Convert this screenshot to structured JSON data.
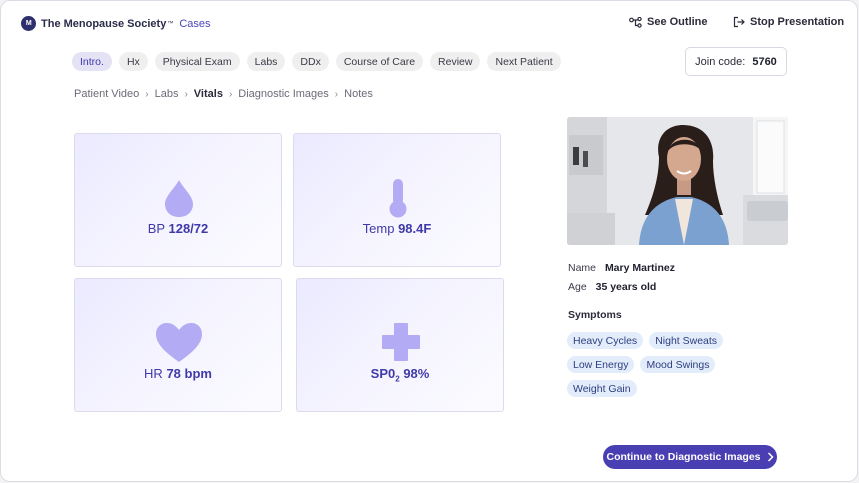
{
  "brand": {
    "mark": "M",
    "name": "The Menopause Society",
    "tm": "™",
    "product": "Cases"
  },
  "header": {
    "outline_label": "See Outline",
    "stop_label": "Stop Presentation"
  },
  "tabs": [
    {
      "label": "Intro.",
      "active": true
    },
    {
      "label": "Hx"
    },
    {
      "label": "Physical Exam"
    },
    {
      "label": "Labs"
    },
    {
      "label": "DDx"
    },
    {
      "label": "Course of Care"
    },
    {
      "label": "Review"
    },
    {
      "label": "Next Patient"
    }
  ],
  "join": {
    "label": "Join code:",
    "code": "5760"
  },
  "breadcrumb": {
    "items": [
      "Patient Video",
      "Labs",
      "Vitals",
      "Diagnostic Images",
      "Notes"
    ],
    "current": "Vitals"
  },
  "vitals": {
    "bp": {
      "label": "BP",
      "value": "128/72",
      "icon": "blood-drop-icon"
    },
    "temp": {
      "label": "Temp",
      "value": "98.4F",
      "icon": "thermometer-icon"
    },
    "hr": {
      "label": "HR",
      "value": "78 bpm",
      "icon": "heart-icon"
    },
    "spo2": {
      "label": "SP0",
      "sub": "2",
      "value": "98%",
      "icon": "medical-cross-icon"
    }
  },
  "patient": {
    "name_label": "Name",
    "name": "Mary Martinez",
    "age_label": "Age",
    "age": "35 years old",
    "symptoms_title": "Symptoms",
    "symptoms": [
      "Heavy Cycles",
      "Night Sweats",
      "Low Energy",
      "Mood Swings",
      "Weight Gain"
    ]
  },
  "continue_label": "Continue to Diagnostic Images",
  "colors": {
    "accent": "#4a3fb2",
    "icon_fill": "#b3acf4",
    "chip_bg": "#e2ecfa",
    "active_tab_bg": "#e4e2f5"
  }
}
